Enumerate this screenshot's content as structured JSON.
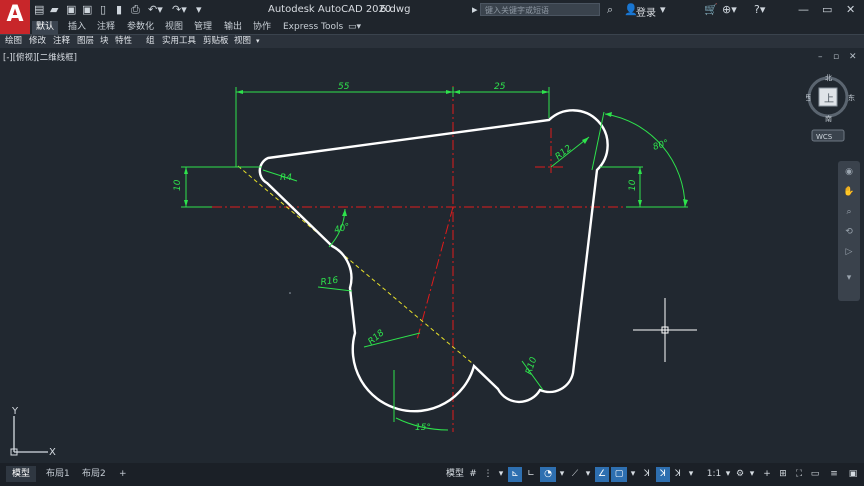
{
  "app": {
    "logo": "A",
    "title": "Autodesk AutoCAD 2020",
    "filename": "6.dwg",
    "search_placeholder": "键入关键字或短语",
    "login_label": "登录"
  },
  "ribbon_tabs": [
    "默认",
    "插入",
    "注释",
    "参数化",
    "视图",
    "管理",
    "输出",
    "协作",
    "Express Tools"
  ],
  "panels": [
    "绘图",
    "修改",
    "注释",
    "图层",
    "块",
    "特性",
    "组",
    "实用工具",
    "剪贴板",
    "视图"
  ],
  "viewport_label": "[-][俯视][二维线框]",
  "viewcube": {
    "north": "北",
    "south": "南",
    "east": "东",
    "west": "西",
    "face": "上",
    "wcs": "WCS"
  },
  "drawing": {
    "dimensions": {
      "horizontal_left": "55",
      "horizontal_right": "25",
      "vertical_left": "10",
      "vertical_right": "10",
      "angle_top_right": "80°",
      "angle_mid": "40°",
      "angle_bottom": "15°",
      "radius_r4": "R4",
      "radius_r12": "R12",
      "radius_r16": "R16",
      "radius_r18": "R18",
      "radius_r10": "R10"
    },
    "colors": {
      "outline": "#ffffff",
      "dimension": "#2ee24c",
      "centerline": "#e01b1b",
      "construction": "#e8e12a",
      "background": "#212830"
    }
  },
  "ucs": {
    "x": "X",
    "y": "Y"
  },
  "layout_tabs": [
    "模型",
    "布局1",
    "布局2",
    "+"
  ],
  "status": {
    "model": "模型",
    "scale": "1:1"
  }
}
